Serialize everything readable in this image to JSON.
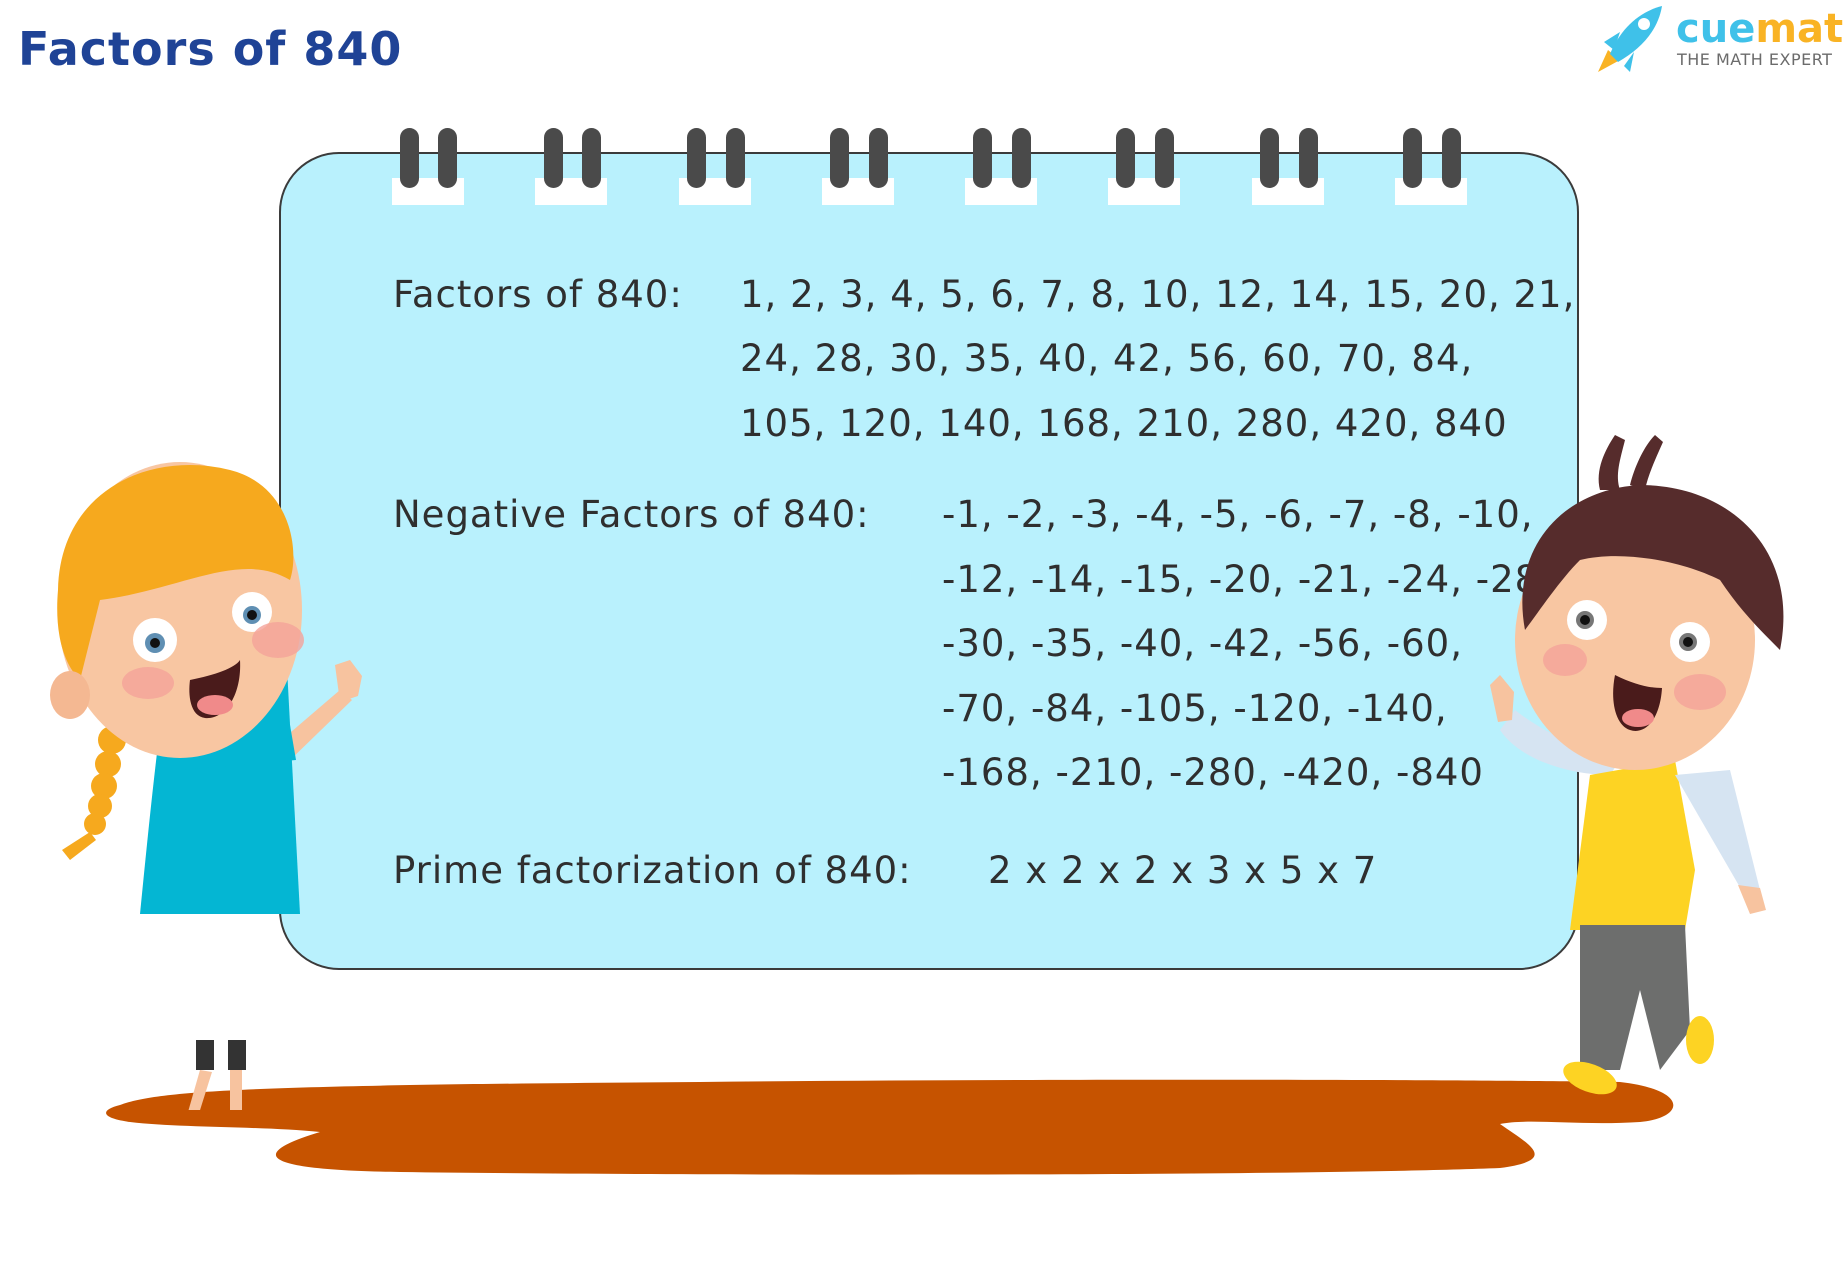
{
  "header": {
    "title": "Factors of 840"
  },
  "logo": {
    "brand_part1": "cue",
    "brand_part2": "math",
    "tagline": "THE MATH EXPERT",
    "icon": "rocket-icon",
    "colors": {
      "cue": "#3fc1e9",
      "math": "#f9b324"
    }
  },
  "board": {
    "factors": {
      "label": "Factors of 840:",
      "lines": [
        "1, 2, 3, 4, 5, 6, 7, 8, 10, 12, 14, 15, 20, 21,",
        "24, 28, 30, 35, 40, 42, 56, 60, 70, 84,",
        "105, 120, 140, 168, 210, 280, 420, 840"
      ]
    },
    "negative_factors": {
      "label": "Negative Factors of 840:",
      "lines": [
        "-1, -2, -3, -4, -5, -6, -7, -8, -10,",
        "-12, -14, -15, -20, -21, -24, -28,",
        "-30, -35, -40, -42, -56, -60,",
        "-70, -84, -105, -120, -140,",
        "-168, -210, -280, -420, -840"
      ]
    },
    "prime_factorization": {
      "label": "Prime factorization of 840:",
      "value": "2 x 2 x 2 x 3 x 5 x 7"
    }
  },
  "colors": {
    "title": "#1f4396",
    "board_fill": "#b9f1fd",
    "board_text": "#2f2f2f",
    "ring": "#4a4a4a",
    "puddle": "#c65300"
  }
}
